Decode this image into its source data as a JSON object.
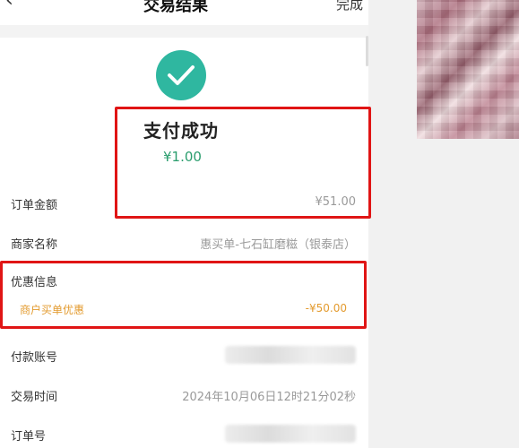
{
  "header": {
    "title": "交易结果",
    "done_label": "完成",
    "back_icon": "chevron-left-icon"
  },
  "status": {
    "icon": "check-circle-icon",
    "text": "支付成功",
    "amount": "¥1.00"
  },
  "details": [
    {
      "label": "订单金额",
      "value": "¥51.00"
    },
    {
      "label": "商家名称",
      "value": "惠买单-七石缸磨糍（银泰店）"
    }
  ],
  "promotion": {
    "header": "优惠信息",
    "label": "商户买单优惠",
    "value": "-¥50.00"
  },
  "more_details": [
    {
      "label": "付款账号",
      "value": ""
    },
    {
      "label": "交易时间",
      "value": "2024年10月06日12时21分02秒"
    },
    {
      "label": "订单号",
      "value": ""
    }
  ],
  "colors": {
    "success": "#2fb7a0",
    "amount": "#2a9d6d",
    "promo": "#e39b2f",
    "highlight_box": "#e01515"
  }
}
